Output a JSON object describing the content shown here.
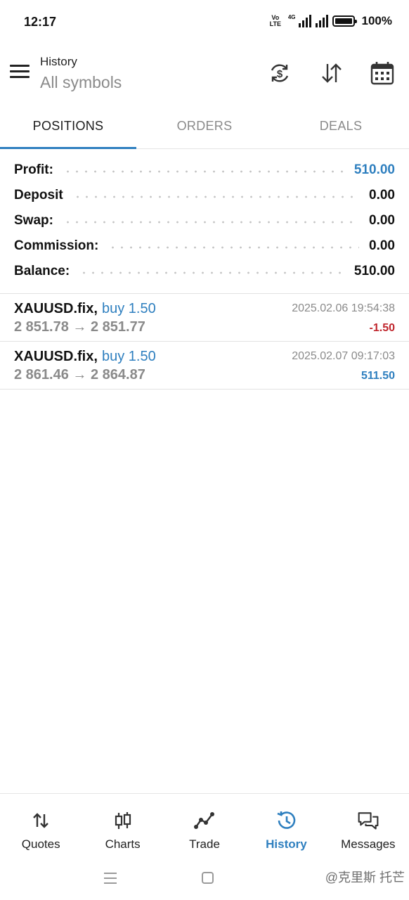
{
  "status_bar": {
    "time": "12:17",
    "volte_top": "Vo",
    "volte_bottom": "LTE",
    "network": "4G",
    "battery": "100%"
  },
  "app_bar": {
    "title": "History",
    "subtitle": "All symbols",
    "icons": [
      "menu-icon",
      "currency-refresh-icon",
      "sort-icon",
      "calendar-icon"
    ]
  },
  "tabs": [
    {
      "label": "POSITIONS",
      "active": true
    },
    {
      "label": "ORDERS",
      "active": false
    },
    {
      "label": "DEALS",
      "active": false
    }
  ],
  "summary": [
    {
      "label": "Profit:",
      "value": "510.00",
      "highlight": true
    },
    {
      "label": "Deposit",
      "value": "0.00"
    },
    {
      "label": "Swap:",
      "value": "0.00"
    },
    {
      "label": "Commission:",
      "value": "0.00"
    },
    {
      "label": "Balance:",
      "value": "510.00"
    }
  ],
  "deals": [
    {
      "symbol": "XAUUSD.fix,",
      "side": "buy 1.50",
      "prices": "2 851.78 → 2 851.77",
      "time": "2025.02.06 19:54:38",
      "profit": "-1.50",
      "profit_sign": "negative"
    },
    {
      "symbol": "XAUUSD.fix,",
      "side": "buy 1.50",
      "prices": "2 861.46 → 2 864.87",
      "time": "2025.02.07 09:17:03",
      "profit": "511.50",
      "profit_sign": "positive"
    }
  ],
  "bottom_nav": [
    {
      "label": "Quotes",
      "icon": "quotes-icon"
    },
    {
      "label": "Charts",
      "icon": "charts-icon"
    },
    {
      "label": "Trade",
      "icon": "trade-icon"
    },
    {
      "label": "History",
      "icon": "history-icon",
      "active": true
    },
    {
      "label": "Messages",
      "icon": "messages-icon"
    }
  ],
  "watermark": "@克里斯 托芒",
  "colors": {
    "accent": "#2e7fbf",
    "negative": "#c0262d",
    "muted": "#8a8a8a"
  }
}
